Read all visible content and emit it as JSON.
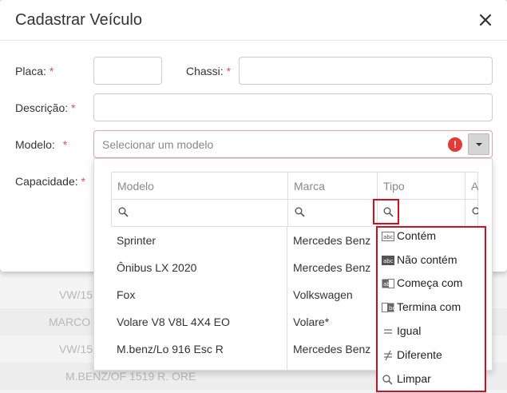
{
  "modal": {
    "title": "Cadastrar Veículo"
  },
  "form": {
    "placa_label": "Placa:",
    "chassi_label": "Chassi:",
    "descricao_label": "Descrição:",
    "modelo_label": "Modelo:",
    "capacidade_label": "Capacidade:",
    "required_mark": "*",
    "modelo_placeholder": "Selecionar um modelo",
    "error_mark": "!"
  },
  "grid": {
    "columns": [
      "Modelo",
      "Marca",
      "Tipo",
      "A"
    ],
    "rows": [
      {
        "modelo": "Sprinter",
        "marca": "Mercedes Benz"
      },
      {
        "modelo": "Ônibus LX 2020",
        "marca": "Mercedes Benz"
      },
      {
        "modelo": "Fox",
        "marca": "Volkswagen"
      },
      {
        "modelo": "Volare V8 V8L 4X4 EO",
        "marca": "Volare*"
      },
      {
        "modelo": "M.benz/Lo 916 Esc R",
        "marca": "Mercedes Benz"
      }
    ]
  },
  "filter_menu": {
    "items": [
      {
        "label": "Contém",
        "icon": "contains-icon"
      },
      {
        "label": "Não contém",
        "icon": "not-contains-icon"
      },
      {
        "label": "Começa com",
        "icon": "starts-with-icon"
      },
      {
        "label": "Termina com",
        "icon": "ends-with-icon"
      },
      {
        "label": "Igual",
        "icon": "equals-icon"
      },
      {
        "label": "Diferente",
        "icon": "not-equal-icon"
      },
      {
        "label": "Limpar",
        "icon": "search-icon"
      }
    ]
  },
  "background": {
    "rows": [
      "VW/15",
      "MARCO",
      "VW/15",
      "M.BENZ/OF 1519 R. ORE"
    ]
  },
  "colors": {
    "required": "#d9534f",
    "error": "#e53935",
    "highlight": "#d01020"
  }
}
